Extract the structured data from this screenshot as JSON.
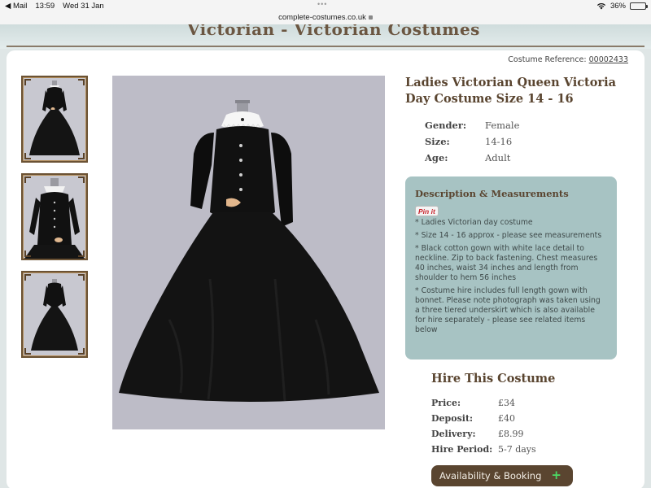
{
  "status_bar": {
    "back_app": "◀ Mail",
    "time": "13:59",
    "date": "Wed 31 Jan",
    "battery": "36%",
    "battery_level": 0.36,
    "battery_color": "#39b54a"
  },
  "url_bar": {
    "domain": "complete-costumes.co.uk"
  },
  "header": {
    "category_title": "Victorian - Victorian Costumes"
  },
  "product": {
    "reference_label": "Costume Reference:",
    "reference_number": "00002433",
    "title": "Ladies Victorian Queen Victoria Day Costume Size 14 - 16",
    "attributes": [
      {
        "label": "Gender:",
        "value": "Female"
      },
      {
        "label": "Size:",
        "value": "14-16"
      },
      {
        "label": "Age:",
        "value": "Adult"
      }
    ],
    "thumbnail_count": 3
  },
  "description": {
    "title": "Description & Measurements",
    "pinit_label": "Pin it",
    "lines": [
      "* Ladies Victorian day costume",
      "* Size 14 - 16 approx - please see measurements",
      "* Black cotton gown with white lace detail to neckline. Zip to back fastening. Chest measures 40 inches, waist 34 inches and length from shoulder to hem 56 inches",
      "* Costume hire includes full length gown with bonnet. Please note photograph was taken using a three tiered underskirt which is also available for hire separately - please see related items below"
    ]
  },
  "hire": {
    "title": "Hire This Costume",
    "rows": [
      {
        "label": "Price:",
        "value": "£34"
      },
      {
        "label": "Deposit:",
        "value": "£40"
      },
      {
        "label": "Delivery:",
        "value": "£8.99"
      },
      {
        "label": "Hire Period:",
        "value": "5-7 days"
      }
    ],
    "booking_label": "Availability & Booking",
    "booking_icon": "+"
  },
  "colors": {
    "brand_brown": "#5a4530",
    "description_bg": "#a7c3c3",
    "accent_green": "#4cd964"
  }
}
